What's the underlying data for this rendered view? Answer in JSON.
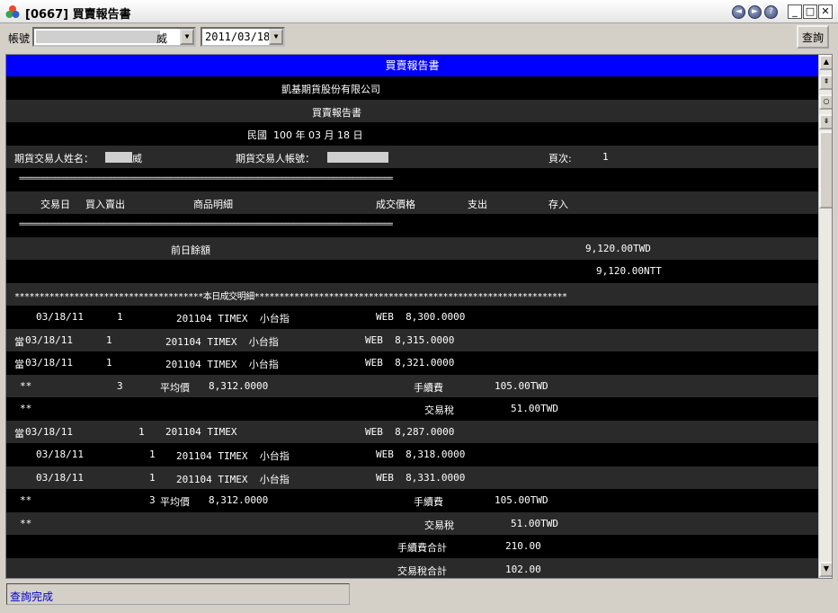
{
  "window": {
    "title": "[0667] 買賣報告書"
  },
  "toolbar": {
    "account_label": "帳號",
    "account_value_suffix": "威",
    "date_value": "2011/03/18",
    "query_label": "查詢"
  },
  "report": {
    "header": "買賣報告書",
    "company": "凱基期貨股份有限公司",
    "subtitle": "買賣報告書",
    "date_line": "民國  100 年 03 月 18 日",
    "trader_name_label": "期貨交易人姓名：",
    "trader_name_suffix": "威",
    "trader_account_label": "期貨交易人帳號：",
    "page_label": "頁次:",
    "page_value": "1",
    "separator": "==============================================================================================",
    "columns": {
      "trade_date": "交易日",
      "buy_sell": "買入賣出",
      "product": "商品明細",
      "price": "成交價格",
      "expense": "支出",
      "deposit": "存入"
    },
    "prev_balance_label": "前日餘額",
    "prev_balance_twd": "9,120.00TWD",
    "prev_balance_ntt": "9,120.00NTT",
    "today_detail_line": "**************************************本日成交明細***************************************************************",
    "trades_group1": [
      {
        "prefix": "",
        "date": "03/18/11",
        "qty": "1",
        "product": "201104 TIMEX  小台指",
        "price": "WEB  8,300.0000"
      },
      {
        "prefix": "當",
        "date": "03/18/11",
        "qty": "1",
        "product": "201104 TIMEX  小台指",
        "price": "WEB  8,315.0000"
      },
      {
        "prefix": "當",
        "date": "03/18/11",
        "qty": "1",
        "product": "201104 TIMEX  小台指",
        "price": "WEB  8,321.0000"
      }
    ],
    "summary1": {
      "marker": "**",
      "qty": "3",
      "avg_label": "平均價",
      "avg_value": "8,312.0000",
      "fee_label": "手續費",
      "fee_value": "105.00TWD",
      "tax_marker": "**",
      "tax_label": "交易稅",
      "tax_value": "51.00TWD"
    },
    "trades_group2": [
      {
        "prefix": "當",
        "date": "03/18/11",
        "qty": "1",
        "product": "201104 TIMEX",
        "price": "WEB  8,287.0000"
      },
      {
        "prefix": "",
        "date": "03/18/11",
        "qty": "1",
        "product": "201104 TIMEX  小台指",
        "price": "WEB  8,318.0000"
      },
      {
        "prefix": "",
        "date": "03/18/11",
        "qty": "1",
        "product": "201104 TIMEX  小台指",
        "price": "WEB  8,331.0000"
      }
    ],
    "summary2": {
      "marker": "**",
      "qty": "3",
      "avg_label": "平均價",
      "avg_value": "8,312.0000",
      "fee_label": "手續費",
      "fee_value": "105.00TWD",
      "tax_marker": "**",
      "tax_label": "交易稅",
      "tax_value": "51.00TWD"
    },
    "fee_total_label": "手續費合計",
    "fee_total_value": "210.00",
    "tax_total_label": "交易稅合計",
    "tax_total_value": "102.00"
  },
  "status": {
    "text": "查詢完成"
  },
  "icons": {
    "app": "app-logo-icon",
    "back": "back-circle-icon",
    "forward": "forward-circle-icon",
    "help": "help-circle-icon",
    "minimize": "minimize-icon",
    "maximize": "maximize-icon",
    "close": "close-icon"
  }
}
